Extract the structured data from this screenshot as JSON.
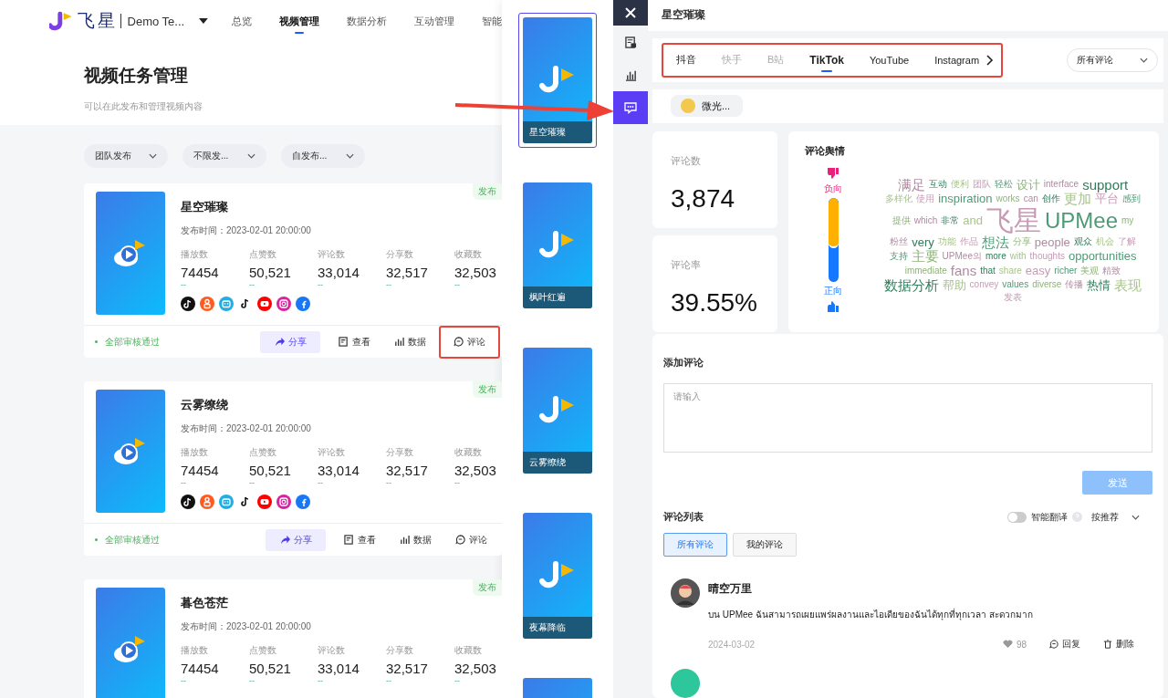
{
  "header": {
    "brand": "飞星",
    "team": "Demo Te...",
    "nav": [
      {
        "label": "总览",
        "selected": false
      },
      {
        "label": "视频管理",
        "selected": true
      },
      {
        "label": "数据分析",
        "selected": false
      },
      {
        "label": "互动管理",
        "selected": false
      },
      {
        "label": "智能",
        "selected": false
      }
    ]
  },
  "page": {
    "title": "视频任务管理",
    "subtitle": "可以在此发布和管理视频内容"
  },
  "filters": [
    "团队发布",
    "不限发...",
    "自发布..."
  ],
  "videos": [
    {
      "title": "星空璀璨",
      "publish_time": "发布时间：2023-02-01 20:00:00",
      "badge": "发布",
      "stats": [
        {
          "label": "播放数",
          "value": "74454",
          "trend": "--"
        },
        {
          "label": "点赞数",
          "value": "50,521",
          "trend": "--"
        },
        {
          "label": "评论数",
          "value": "33,014",
          "trend": "--"
        },
        {
          "label": "分享数",
          "value": "32,517",
          "trend": "--"
        },
        {
          "label": "收藏数",
          "value": "32,503",
          "trend": "--"
        }
      ],
      "platforms": [
        {
          "kind": "douyin"
        },
        {
          "kind": "kuaishou"
        },
        {
          "kind": "bilibili"
        },
        {
          "kind": "tiktok"
        },
        {
          "kind": "youtube"
        },
        {
          "kind": "instagram"
        },
        {
          "kind": "facebook"
        }
      ],
      "status": "全部审核通过",
      "actions": [
        {
          "kind": "share",
          "label": "分享",
          "highlighted": false
        },
        {
          "kind": "view",
          "label": "查看",
          "highlighted": false
        },
        {
          "kind": "data",
          "label": "数据",
          "highlighted": false
        },
        {
          "kind": "comment",
          "label": "评论",
          "highlighted": true
        }
      ]
    },
    {
      "title": "云雾缭绕",
      "publish_time": "发布时间：2023-02-01 20:00:00",
      "badge": "发布",
      "stats": [
        {
          "label": "播放数",
          "value": "74454",
          "trend": "--"
        },
        {
          "label": "点赞数",
          "value": "50,521",
          "trend": "--"
        },
        {
          "label": "评论数",
          "value": "33,014",
          "trend": "--"
        },
        {
          "label": "分享数",
          "value": "32,517",
          "trend": "--"
        },
        {
          "label": "收藏数",
          "value": "32,503",
          "trend": "--"
        }
      ],
      "platforms": [
        {
          "kind": "douyin"
        },
        {
          "kind": "kuaishou"
        },
        {
          "kind": "bilibili"
        },
        {
          "kind": "tiktok"
        },
        {
          "kind": "youtube"
        },
        {
          "kind": "instagram"
        },
        {
          "kind": "facebook"
        }
      ],
      "status": "全部审核通过",
      "actions": [
        {
          "kind": "share",
          "label": "分享",
          "highlighted": false
        },
        {
          "kind": "view",
          "label": "查看",
          "highlighted": false
        },
        {
          "kind": "data",
          "label": "数据",
          "highlighted": false
        },
        {
          "kind": "comment",
          "label": "评论",
          "highlighted": false
        }
      ]
    },
    {
      "title": "暮色苍茫",
      "publish_time": "发布时间：2023-02-01 20:00:00",
      "badge": "发布",
      "stats": [
        {
          "label": "播放数",
          "value": "74454",
          "trend": "--"
        },
        {
          "label": "点赞数",
          "value": "50,521",
          "trend": "--"
        },
        {
          "label": "评论数",
          "value": "33,014",
          "trend": "--"
        },
        {
          "label": "分享数",
          "value": "32,517",
          "trend": "--"
        },
        {
          "label": "收藏数",
          "value": "32,503",
          "trend": "--"
        }
      ]
    }
  ],
  "thumbnails": [
    {
      "title": "星空璀璨",
      "selected": true
    },
    {
      "title": "枫叶红遍",
      "selected": false
    },
    {
      "title": "云雾缭绕",
      "selected": false
    },
    {
      "title": "夜幕降临",
      "selected": false
    },
    {
      "selected": false
    }
  ],
  "rail": [
    {
      "kind": "view",
      "selected": false
    },
    {
      "kind": "data",
      "selected": false
    },
    {
      "kind": "comment",
      "selected": true
    }
  ],
  "panel": {
    "title": "星空璀璨",
    "platform_tabs": {
      "highlighted": true,
      "items": [
        {
          "label": "抖音",
          "selected": false,
          "disabled": false
        },
        {
          "label": "快手",
          "selected": false,
          "disabled": true
        },
        {
          "label": "B站",
          "selected": false,
          "disabled": true
        },
        {
          "label": "TikTok",
          "selected": true,
          "disabled": false
        },
        {
          "label": "YouTube",
          "selected": false,
          "disabled": false
        },
        {
          "label": "Instagram",
          "selected": false,
          "disabled": false
        }
      ]
    },
    "comment_filter": "所有评论",
    "account": "微光...",
    "stats": [
      {
        "label": "评论数",
        "value": "3,874"
      },
      {
        "label": "评论率",
        "value": "39.55%"
      }
    ],
    "sentiment": {
      "title": "评论舆情",
      "negative_label": "负向",
      "positive_label": "正向",
      "level": 0.6
    },
    "word_cloud": [
      "满足",
      "互动",
      "便利",
      "团队",
      "轻松",
      "设计",
      "interface",
      "support",
      "多样化",
      "使用",
      "inspiration",
      "works",
      "can",
      "创作",
      "更加",
      "平台",
      "感到",
      "提供",
      "which",
      "非常",
      "and",
      "飞星",
      "UPMee",
      "my",
      "粉丝",
      "very",
      "功能",
      "作品",
      "想法",
      "分享",
      "people",
      "观众",
      "机会",
      "了解",
      "支持",
      "主要",
      "UPMee의",
      "more",
      "with",
      "thoughts",
      "opportunities",
      "immediate",
      "fans",
      "that",
      "share",
      "easy",
      "richer",
      "美观",
      "精致",
      "数据分析",
      "帮助",
      "convey",
      "values",
      "diverse",
      "传播",
      "热情",
      "表现",
      "发表"
    ],
    "add_comment": {
      "title": "添加评论",
      "placeholder": "请输入",
      "send": "发送"
    },
    "list": {
      "title": "评论列表",
      "translate": {
        "label": "智能翻译",
        "on": false
      },
      "sort": "按推荐",
      "filters": [
        {
          "label": "所有评论",
          "selected": true
        },
        {
          "label": "我的评论",
          "selected": false
        }
      ],
      "comments": [
        {
          "user": "晴空万里",
          "text": "บน UPMee ฉันสามารถเผยแพร่ผลงานและไอเดียของฉันได้ทุกที่ทุกเวลา สะดวกมาก",
          "date": "2024-03-02",
          "likes": "98",
          "reply": "回复",
          "delete": "删除"
        }
      ]
    }
  },
  "annotation": {
    "arrow": true
  }
}
